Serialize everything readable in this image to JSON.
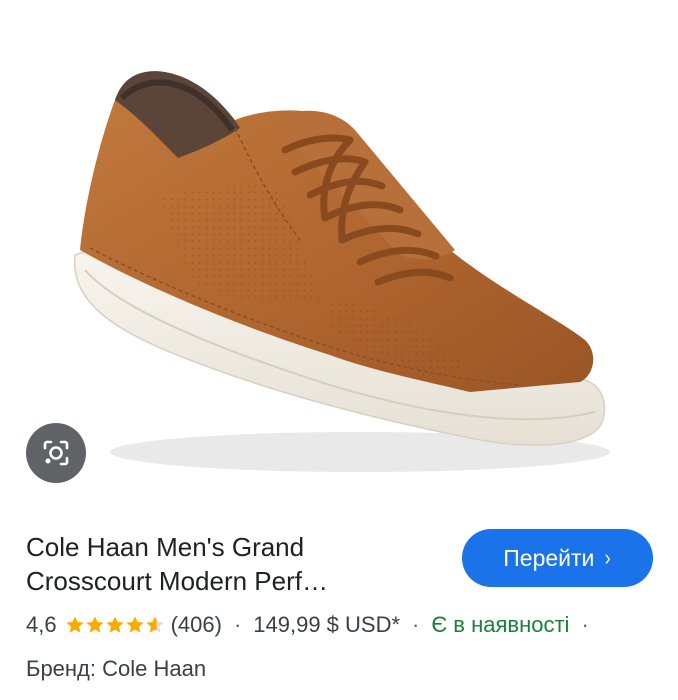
{
  "product": {
    "title_line1": "Cole Haan Men's Grand",
    "title_line2": "Crosscourt Modern Perf…",
    "rating": "4,6",
    "rating_value": 4.6,
    "rating_max": 5,
    "reviews": "(406)",
    "price": "149,99 $ USD*",
    "availability": "Є в наявності",
    "brand": "Бренд: Cole Haan"
  },
  "actions": {
    "go_label": "Перейти",
    "go_chevron": "›"
  },
  "image": {
    "subject": "brown suede sneaker with white sole",
    "lens_icon": "google-lens-icon"
  },
  "colors": {
    "accent": "#1a73e8",
    "star": "#f9ab00",
    "in_stock": "#188038",
    "shoe_upper": "#b46a32",
    "sole": "#f3efe6"
  }
}
